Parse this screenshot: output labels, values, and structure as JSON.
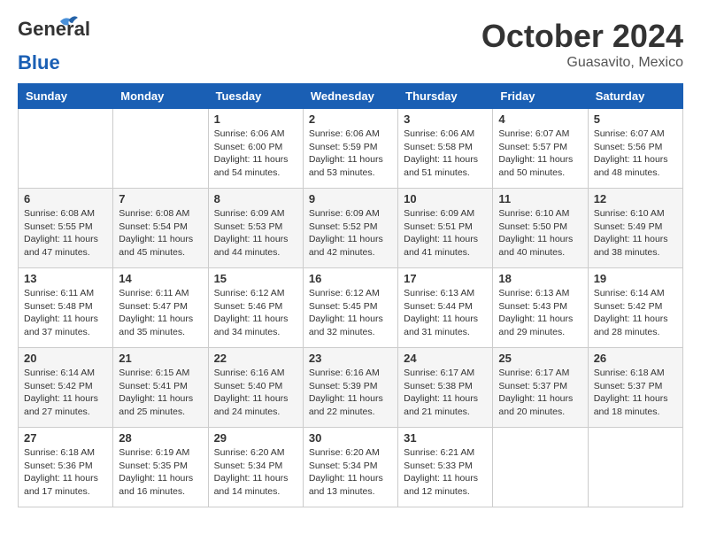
{
  "header": {
    "logo_general": "General",
    "logo_blue": "Blue",
    "month_title": "October 2024",
    "location": "Guasavito, Mexico"
  },
  "weekdays": [
    "Sunday",
    "Monday",
    "Tuesday",
    "Wednesday",
    "Thursday",
    "Friday",
    "Saturday"
  ],
  "weeks": [
    [
      null,
      null,
      {
        "day": 1,
        "sunrise": "6:06 AM",
        "sunset": "6:00 PM",
        "daylight": "11 hours and 54 minutes."
      },
      {
        "day": 2,
        "sunrise": "6:06 AM",
        "sunset": "5:59 PM",
        "daylight": "11 hours and 53 minutes."
      },
      {
        "day": 3,
        "sunrise": "6:06 AM",
        "sunset": "5:58 PM",
        "daylight": "11 hours and 51 minutes."
      },
      {
        "day": 4,
        "sunrise": "6:07 AM",
        "sunset": "5:57 PM",
        "daylight": "11 hours and 50 minutes."
      },
      {
        "day": 5,
        "sunrise": "6:07 AM",
        "sunset": "5:56 PM",
        "daylight": "11 hours and 48 minutes."
      }
    ],
    [
      {
        "day": 6,
        "sunrise": "6:08 AM",
        "sunset": "5:55 PM",
        "daylight": "11 hours and 47 minutes."
      },
      {
        "day": 7,
        "sunrise": "6:08 AM",
        "sunset": "5:54 PM",
        "daylight": "11 hours and 45 minutes."
      },
      {
        "day": 8,
        "sunrise": "6:09 AM",
        "sunset": "5:53 PM",
        "daylight": "11 hours and 44 minutes."
      },
      {
        "day": 9,
        "sunrise": "6:09 AM",
        "sunset": "5:52 PM",
        "daylight": "11 hours and 42 minutes."
      },
      {
        "day": 10,
        "sunrise": "6:09 AM",
        "sunset": "5:51 PM",
        "daylight": "11 hours and 41 minutes."
      },
      {
        "day": 11,
        "sunrise": "6:10 AM",
        "sunset": "5:50 PM",
        "daylight": "11 hours and 40 minutes."
      },
      {
        "day": 12,
        "sunrise": "6:10 AM",
        "sunset": "5:49 PM",
        "daylight": "11 hours and 38 minutes."
      }
    ],
    [
      {
        "day": 13,
        "sunrise": "6:11 AM",
        "sunset": "5:48 PM",
        "daylight": "11 hours and 37 minutes."
      },
      {
        "day": 14,
        "sunrise": "6:11 AM",
        "sunset": "5:47 PM",
        "daylight": "11 hours and 35 minutes."
      },
      {
        "day": 15,
        "sunrise": "6:12 AM",
        "sunset": "5:46 PM",
        "daylight": "11 hours and 34 minutes."
      },
      {
        "day": 16,
        "sunrise": "6:12 AM",
        "sunset": "5:45 PM",
        "daylight": "11 hours and 32 minutes."
      },
      {
        "day": 17,
        "sunrise": "6:13 AM",
        "sunset": "5:44 PM",
        "daylight": "11 hours and 31 minutes."
      },
      {
        "day": 18,
        "sunrise": "6:13 AM",
        "sunset": "5:43 PM",
        "daylight": "11 hours and 29 minutes."
      },
      {
        "day": 19,
        "sunrise": "6:14 AM",
        "sunset": "5:42 PM",
        "daylight": "11 hours and 28 minutes."
      }
    ],
    [
      {
        "day": 20,
        "sunrise": "6:14 AM",
        "sunset": "5:42 PM",
        "daylight": "11 hours and 27 minutes."
      },
      {
        "day": 21,
        "sunrise": "6:15 AM",
        "sunset": "5:41 PM",
        "daylight": "11 hours and 25 minutes."
      },
      {
        "day": 22,
        "sunrise": "6:16 AM",
        "sunset": "5:40 PM",
        "daylight": "11 hours and 24 minutes."
      },
      {
        "day": 23,
        "sunrise": "6:16 AM",
        "sunset": "5:39 PM",
        "daylight": "11 hours and 22 minutes."
      },
      {
        "day": 24,
        "sunrise": "6:17 AM",
        "sunset": "5:38 PM",
        "daylight": "11 hours and 21 minutes."
      },
      {
        "day": 25,
        "sunrise": "6:17 AM",
        "sunset": "5:37 PM",
        "daylight": "11 hours and 20 minutes."
      },
      {
        "day": 26,
        "sunrise": "6:18 AM",
        "sunset": "5:37 PM",
        "daylight": "11 hours and 18 minutes."
      }
    ],
    [
      {
        "day": 27,
        "sunrise": "6:18 AM",
        "sunset": "5:36 PM",
        "daylight": "11 hours and 17 minutes."
      },
      {
        "day": 28,
        "sunrise": "6:19 AM",
        "sunset": "5:35 PM",
        "daylight": "11 hours and 16 minutes."
      },
      {
        "day": 29,
        "sunrise": "6:20 AM",
        "sunset": "5:34 PM",
        "daylight": "11 hours and 14 minutes."
      },
      {
        "day": 30,
        "sunrise": "6:20 AM",
        "sunset": "5:34 PM",
        "daylight": "11 hours and 13 minutes."
      },
      {
        "day": 31,
        "sunrise": "6:21 AM",
        "sunset": "5:33 PM",
        "daylight": "11 hours and 12 minutes."
      },
      null,
      null
    ]
  ]
}
